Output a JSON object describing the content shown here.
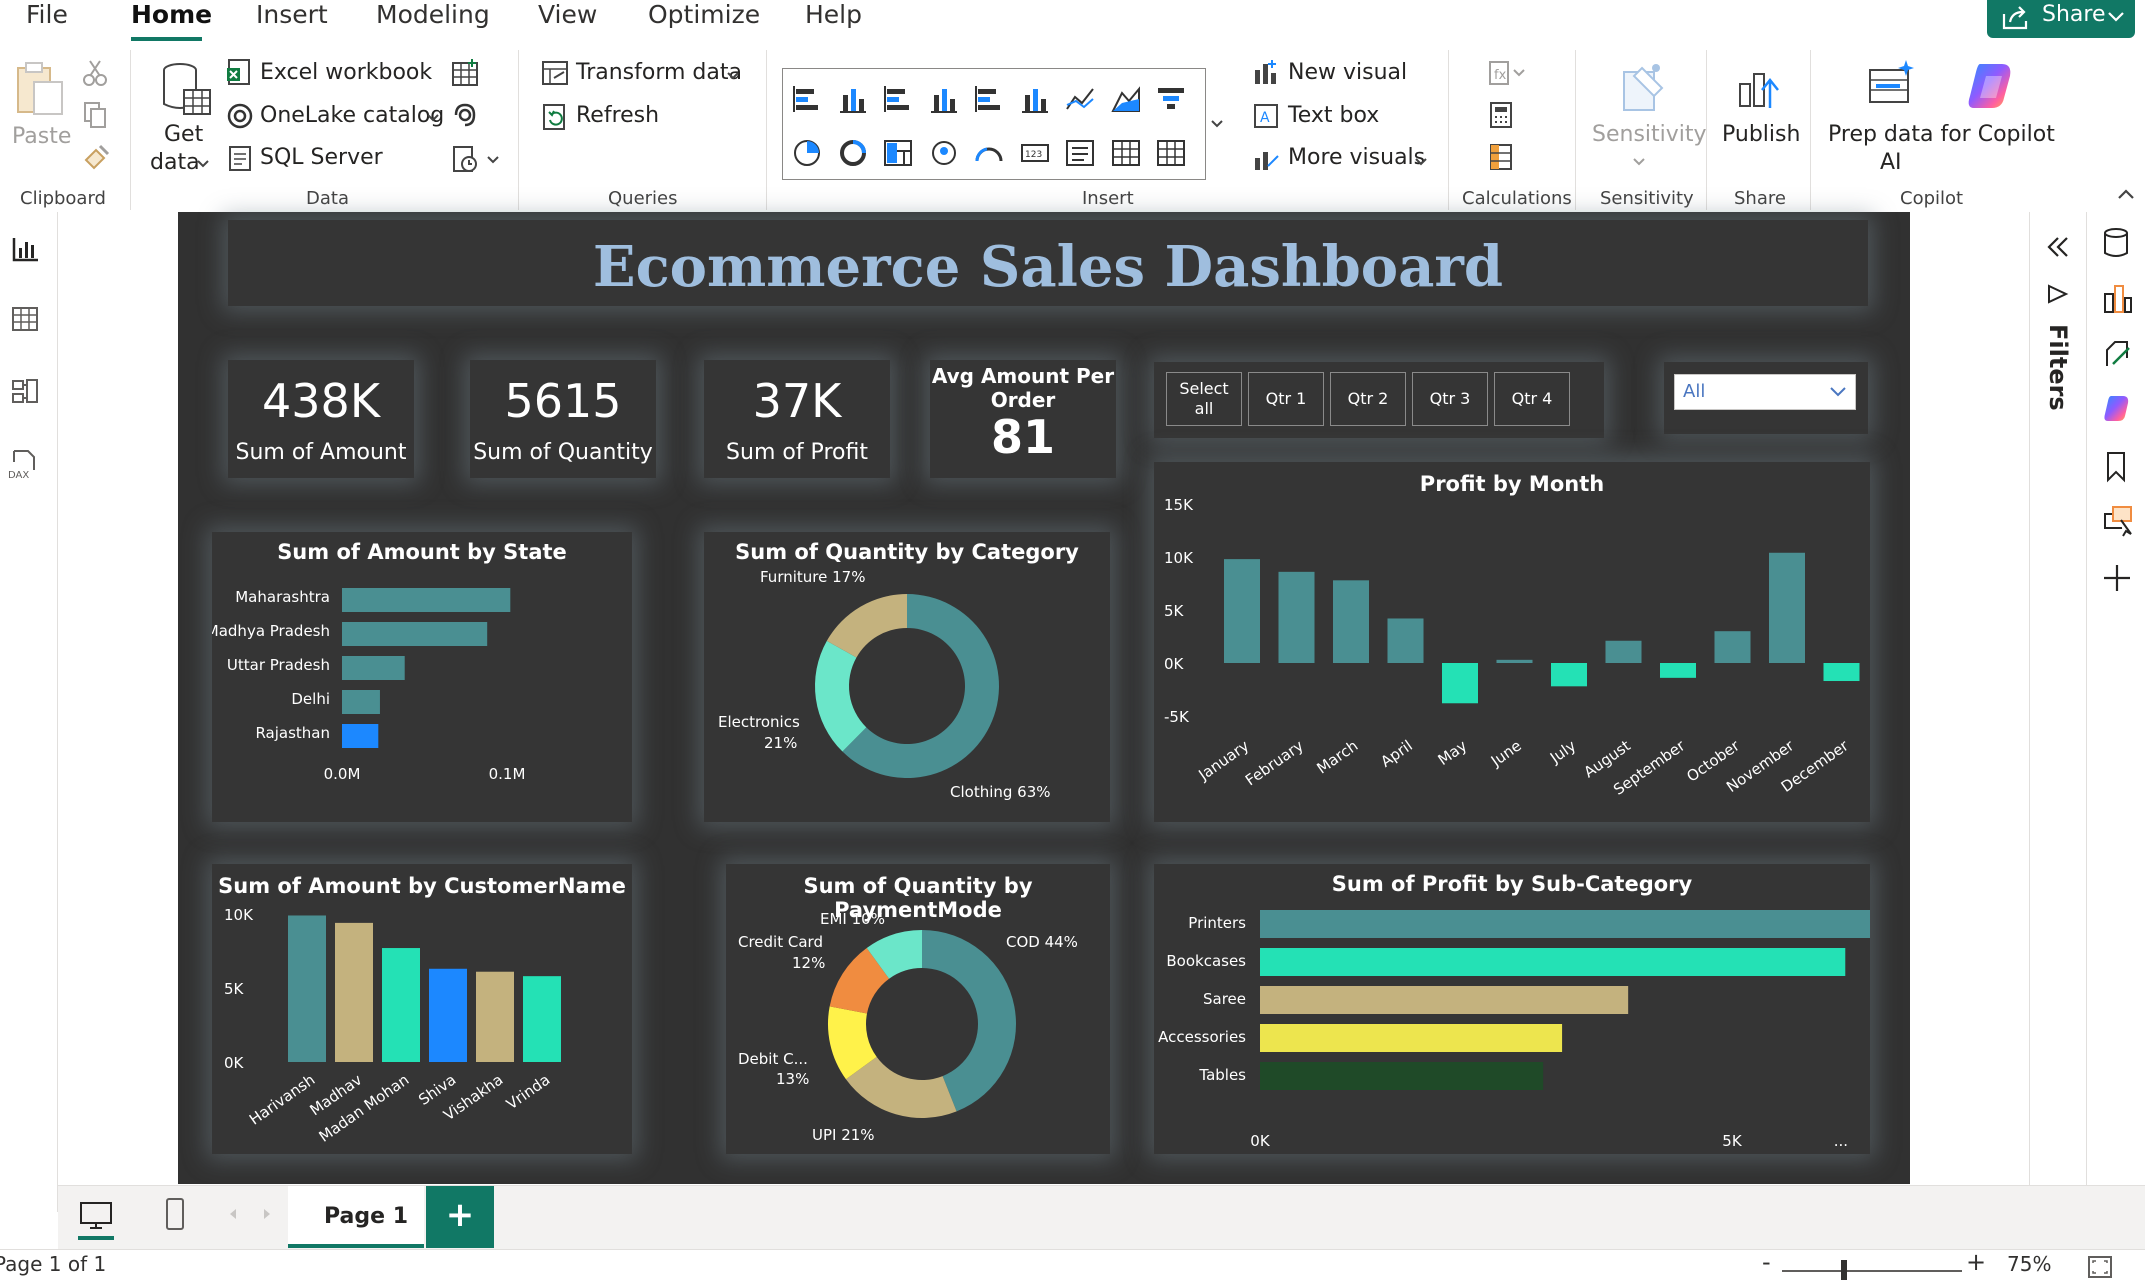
{
  "menu": {
    "items": [
      "File",
      "Home",
      "Insert",
      "Modeling",
      "View",
      "Optimize",
      "Help"
    ],
    "share_label": "Share"
  },
  "ribbon": {
    "clipboard": {
      "paste": "Paste",
      "group": "Clipboard"
    },
    "data": {
      "get_data": "Get",
      "get_data2": "data",
      "excel": "Excel workbook",
      "onelake": "OneLake catalog",
      "sql": "SQL Server",
      "group": "Data"
    },
    "queries": {
      "transform": "Transform data",
      "refresh": "Refresh",
      "group": "Queries"
    },
    "insert": {
      "new_visual": "New visual",
      "text_box": "Text box",
      "more_visuals": "More visuals",
      "group": "Insert"
    },
    "calculations": {
      "group": "Calculations"
    },
    "sensitivity": {
      "label": "Sensitivity",
      "group": "Sensitivity"
    },
    "share": {
      "publish": "Publish",
      "group": "Share"
    },
    "copilot": {
      "prep1": "Prep data for Copilot",
      "prep2": "AI",
      "group": "Copilot"
    }
  },
  "dashboard": {
    "title": "Ecommerce Sales Dashboard",
    "kpis": [
      {
        "value": "438K",
        "label": "Sum of Amount"
      },
      {
        "value": "5615",
        "label": "Sum of Quantity"
      },
      {
        "value": "37K",
        "label": "Sum of Profit"
      },
      {
        "value": "81",
        "label1": "Avg Amount Per",
        "label2": "Order"
      }
    ],
    "slicer": {
      "select_all_1": "Select",
      "select_all_2": "all",
      "options": [
        "Qtr 1",
        "Qtr 2",
        "Qtr 3",
        "Qtr 4"
      ]
    },
    "dropdown": {
      "value": "All"
    },
    "accent_colors": {
      "teal": "#4a8f92",
      "sand": "#c4b27e",
      "mint": "#24e1b5",
      "blue": "#1c88ff",
      "yellow": "#ede54e",
      "orange": "#f08c40",
      "light_mint": "#6be6c9",
      "bright_yellow": "#fff24a",
      "dark_green": "#1f4a28"
    }
  },
  "chart_data": [
    {
      "type": "bar",
      "orientation": "horizontal",
      "title": "Sum of Amount by State",
      "categories": [
        "Maharashtra",
        "Madhya Pradesh",
        "Uttar Pradesh",
        "Delhi",
        "Rajasthan"
      ],
      "values": [
        102000,
        88000,
        38000,
        23000,
        22000
      ],
      "x_ticks": [
        "0.0M",
        "0.1M"
      ],
      "xlim": [
        0,
        100000
      ]
    },
    {
      "type": "pie",
      "donut": true,
      "title": "Sum of Quantity by Category",
      "categories": [
        "Clothing",
        "Electronics",
        "Furniture"
      ],
      "values": [
        63,
        21,
        17
      ],
      "labels": [
        "Clothing 63%",
        "Electronics",
        "21%",
        "Furniture 17%"
      ]
    },
    {
      "type": "bar",
      "title": "Profit by Month",
      "categories": [
        "January",
        "February",
        "March",
        "April",
        "May",
        "June",
        "July",
        "August",
        "September",
        "October",
        "November",
        "December"
      ],
      "values": [
        9800,
        8600,
        7800,
        4200,
        -3800,
        300,
        -2200,
        2100,
        -1400,
        3000,
        10400,
        -1700
      ],
      "y_ticks": [
        "15K",
        "10K",
        "5K",
        "0K",
        "-5K"
      ],
      "ylim": [
        -5000,
        15000
      ]
    },
    {
      "type": "bar",
      "title": "Sum of Amount by CustomerName",
      "categories": [
        "Harivansh",
        "Madhav",
        "Madan Mohan",
        "Shiva",
        "Vishakha",
        "Vrinda"
      ],
      "values": [
        9900,
        9400,
        7700,
        6300,
        6100,
        5800
      ],
      "y_ticks": [
        "10K",
        "5K",
        "0K"
      ],
      "ylim": [
        0,
        10000
      ]
    },
    {
      "type": "pie",
      "donut": true,
      "title": "Sum of Quantity by PaymentMode",
      "categories": [
        "COD",
        "UPI",
        "Debit Card",
        "Credit Card",
        "EMI"
      ],
      "values": [
        44,
        21,
        13,
        12,
        10
      ],
      "labels": [
        "COD 44%",
        "UPI 21%",
        "Debit C...",
        "13%",
        "Credit Card",
        "12%",
        "EMI 10%"
      ]
    },
    {
      "type": "bar",
      "orientation": "horizontal",
      "title": "Sum of Profit by Sub-Category",
      "categories": [
        "Printers",
        "Bookcases",
        "Saree",
        "Accessories",
        "Tables"
      ],
      "values": [
        8200,
        6200,
        3900,
        3200,
        3000
      ],
      "x_ticks": [
        "0K",
        "5K"
      ],
      "xlim": [
        0,
        5000
      ],
      "more_label": "..."
    }
  ],
  "filters": {
    "label": "Filters"
  },
  "pages": {
    "tab": "Page 1",
    "add": "+"
  },
  "status": {
    "page": "Page 1 of 1",
    "zoom": "75%",
    "minus": "-",
    "plus": "+"
  }
}
